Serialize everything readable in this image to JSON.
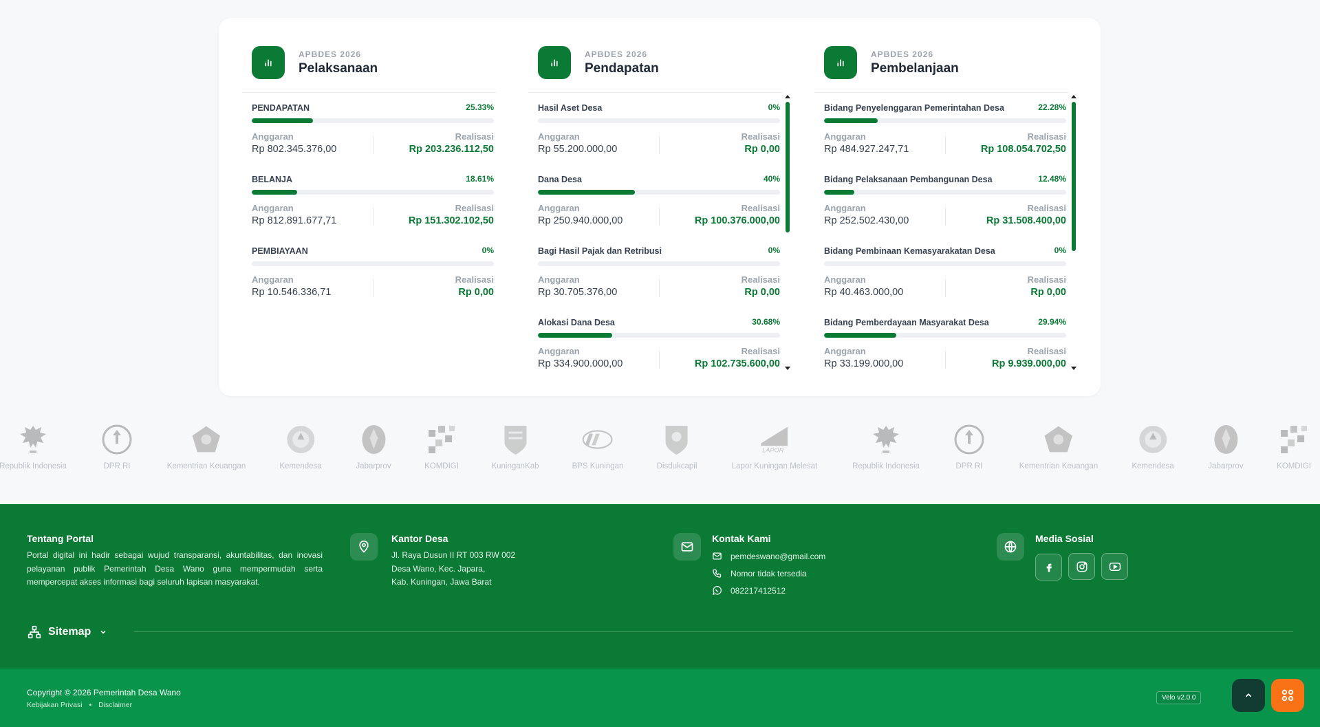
{
  "colors": {
    "primary": "#0a7a35",
    "footer": "#0a7a35",
    "footer_bottom": "#08944a",
    "accent_button": "#f97316"
  },
  "columns": [
    {
      "eyebrow": "APBDES 2026",
      "title": "Pelaksanaan",
      "icon": "bar-chart-icon",
      "scrollbar": false,
      "items": [
        {
          "name": "PENDAPATAN",
          "percent": "25.33%",
          "progress": 25.33,
          "anggaran_label": "Anggaran",
          "anggaran": "Rp 802.345.376,00",
          "realisasi_label": "Realisasi",
          "realisasi": "Rp 203.236.112,50"
        },
        {
          "name": "BELANJA",
          "percent": "18.61%",
          "progress": 18.61,
          "anggaran_label": "Anggaran",
          "anggaran": "Rp 812.891.677,71",
          "realisasi_label": "Realisasi",
          "realisasi": "Rp 151.302.102,50"
        },
        {
          "name": "PEMBIAYAAN",
          "percent": "0%",
          "progress": 0,
          "anggaran_label": "Anggaran",
          "anggaran": "Rp 10.546.336,71",
          "realisasi_label": "Realisasi",
          "realisasi": "Rp 0,00"
        }
      ]
    },
    {
      "eyebrow": "APBDES 2026",
      "title": "Pendapatan",
      "icon": "bar-chart-icon",
      "scrollbar": true,
      "scroll_fraction": 0.5,
      "items": [
        {
          "name": "Hasil Aset Desa",
          "percent": "0%",
          "progress": 0,
          "anggaran_label": "Anggaran",
          "anggaran": "Rp 55.200.000,00",
          "realisasi_label": "Realisasi",
          "realisasi": "Rp 0,00"
        },
        {
          "name": "Dana Desa",
          "percent": "40%",
          "progress": 40,
          "anggaran_label": "Anggaran",
          "anggaran": "Rp 250.940.000,00",
          "realisasi_label": "Realisasi",
          "realisasi": "Rp 100.376.000,00"
        },
        {
          "name": "Bagi Hasil Pajak dan Retribusi",
          "percent": "0%",
          "progress": 0,
          "anggaran_label": "Anggaran",
          "anggaran": "Rp 30.705.376,00",
          "realisasi_label": "Realisasi",
          "realisasi": "Rp 0,00"
        },
        {
          "name": "Alokasi Dana Desa",
          "percent": "30.68%",
          "progress": 30.68,
          "anggaran_label": "Anggaran",
          "anggaran": "Rp 334.900.000,00",
          "realisasi_label": "Realisasi",
          "realisasi": "Rp 102.735.600,00"
        }
      ]
    },
    {
      "eyebrow": "APBDES 2026",
      "title": "Pembelanjaan",
      "icon": "bar-chart-icon",
      "scrollbar": true,
      "scroll_fraction": 0.57,
      "items": [
        {
          "name": "Bidang Penyelenggaran Pemerintahan Desa",
          "percent": "22.28%",
          "progress": 22.28,
          "anggaran_label": "Anggaran",
          "anggaran": "Rp 484.927.247,71",
          "realisasi_label": "Realisasi",
          "realisasi": "Rp 108.054.702,50"
        },
        {
          "name": "Bidang Pelaksanaan Pembangunan Desa",
          "percent": "12.48%",
          "progress": 12.48,
          "anggaran_label": "Anggaran",
          "anggaran": "Rp 252.502.430,00",
          "realisasi_label": "Realisasi",
          "realisasi": "Rp 31.508.400,00"
        },
        {
          "name": "Bidang Pembinaan Kemasyarakatan Desa",
          "percent": "0%",
          "progress": 0,
          "anggaran_label": "Anggaran",
          "anggaran": "Rp 40.463.000,00",
          "realisasi_label": "Realisasi",
          "realisasi": "Rp 0,00"
        },
        {
          "name": "Bidang Pemberdayaan Masyarakat Desa",
          "percent": "29.94%",
          "progress": 29.94,
          "anggaran_label": "Anggaran",
          "anggaran": "Rp 33.199.000,00",
          "realisasi_label": "Realisasi",
          "realisasi": "Rp 9.939.000,00"
        }
      ]
    }
  ],
  "logos": [
    {
      "name": "Republik Indonesia",
      "icon": "garuda-emblem-icon"
    },
    {
      "name": "DPR RI",
      "icon": "dpr-emblem-icon"
    },
    {
      "name": "Kementrian Keuangan",
      "icon": "kemenkeu-emblem-icon"
    },
    {
      "name": "Kemendesa",
      "icon": "kemendesa-emblem-icon"
    },
    {
      "name": "Jabarprov",
      "icon": "jabar-emblem-icon"
    },
    {
      "name": "KOMDIGI",
      "icon": "komdigi-logo-icon"
    },
    {
      "name": "KuninganKab",
      "icon": "kuningan-emblem-icon"
    },
    {
      "name": "BPS Kuningan",
      "icon": "bps-logo-icon"
    },
    {
      "name": "Disdukcapil",
      "icon": "disdukcapil-emblem-icon"
    },
    {
      "name": "Lapor Kuningan Melesat",
      "icon": "lapor-logo-icon"
    },
    {
      "name": "Republik Indonesia",
      "icon": "garuda-emblem-icon"
    },
    {
      "name": "DPR RI",
      "icon": "dpr-emblem-icon"
    },
    {
      "name": "Kementrian Keuangan",
      "icon": "kemenkeu-emblem-icon"
    },
    {
      "name": "Kemendesa",
      "icon": "kemendesa-emblem-icon"
    },
    {
      "name": "Jabarprov",
      "icon": "jabar-emblem-icon"
    },
    {
      "name": "KOMDIGI",
      "icon": "komdigi-logo-icon"
    }
  ],
  "footer": {
    "about": {
      "title": "Tentang Portal",
      "text": "Portal digital ini hadir sebagai wujud transparansi, akuntabilitas, dan inovasi pelayanan publik Pemerintah Desa Wano guna mempermudah serta mempercepat akses informasi bagi seluruh lapisan masyarakat."
    },
    "office": {
      "title": "Kantor Desa",
      "line1": "Jl. Raya Dusun II RT 003 RW 002",
      "line2": "Desa Wano, Kec. Japara,",
      "line3": "Kab. Kuningan, Jawa Barat"
    },
    "contact": {
      "title": "Kontak Kami",
      "email": "pemdeswano@gmail.com",
      "phone": "Nomor tidak tersedia",
      "whatsapp": "082217412512"
    },
    "social": {
      "title": "Media Sosial"
    },
    "sitemap_label": "Sitemap",
    "copyright": "Copyright © 2026 Pemerintah Desa Wano",
    "privacy": "Kebijakan Privasi",
    "disclaimer": "Disclaimer",
    "version": "Velo v2.0.0"
  }
}
